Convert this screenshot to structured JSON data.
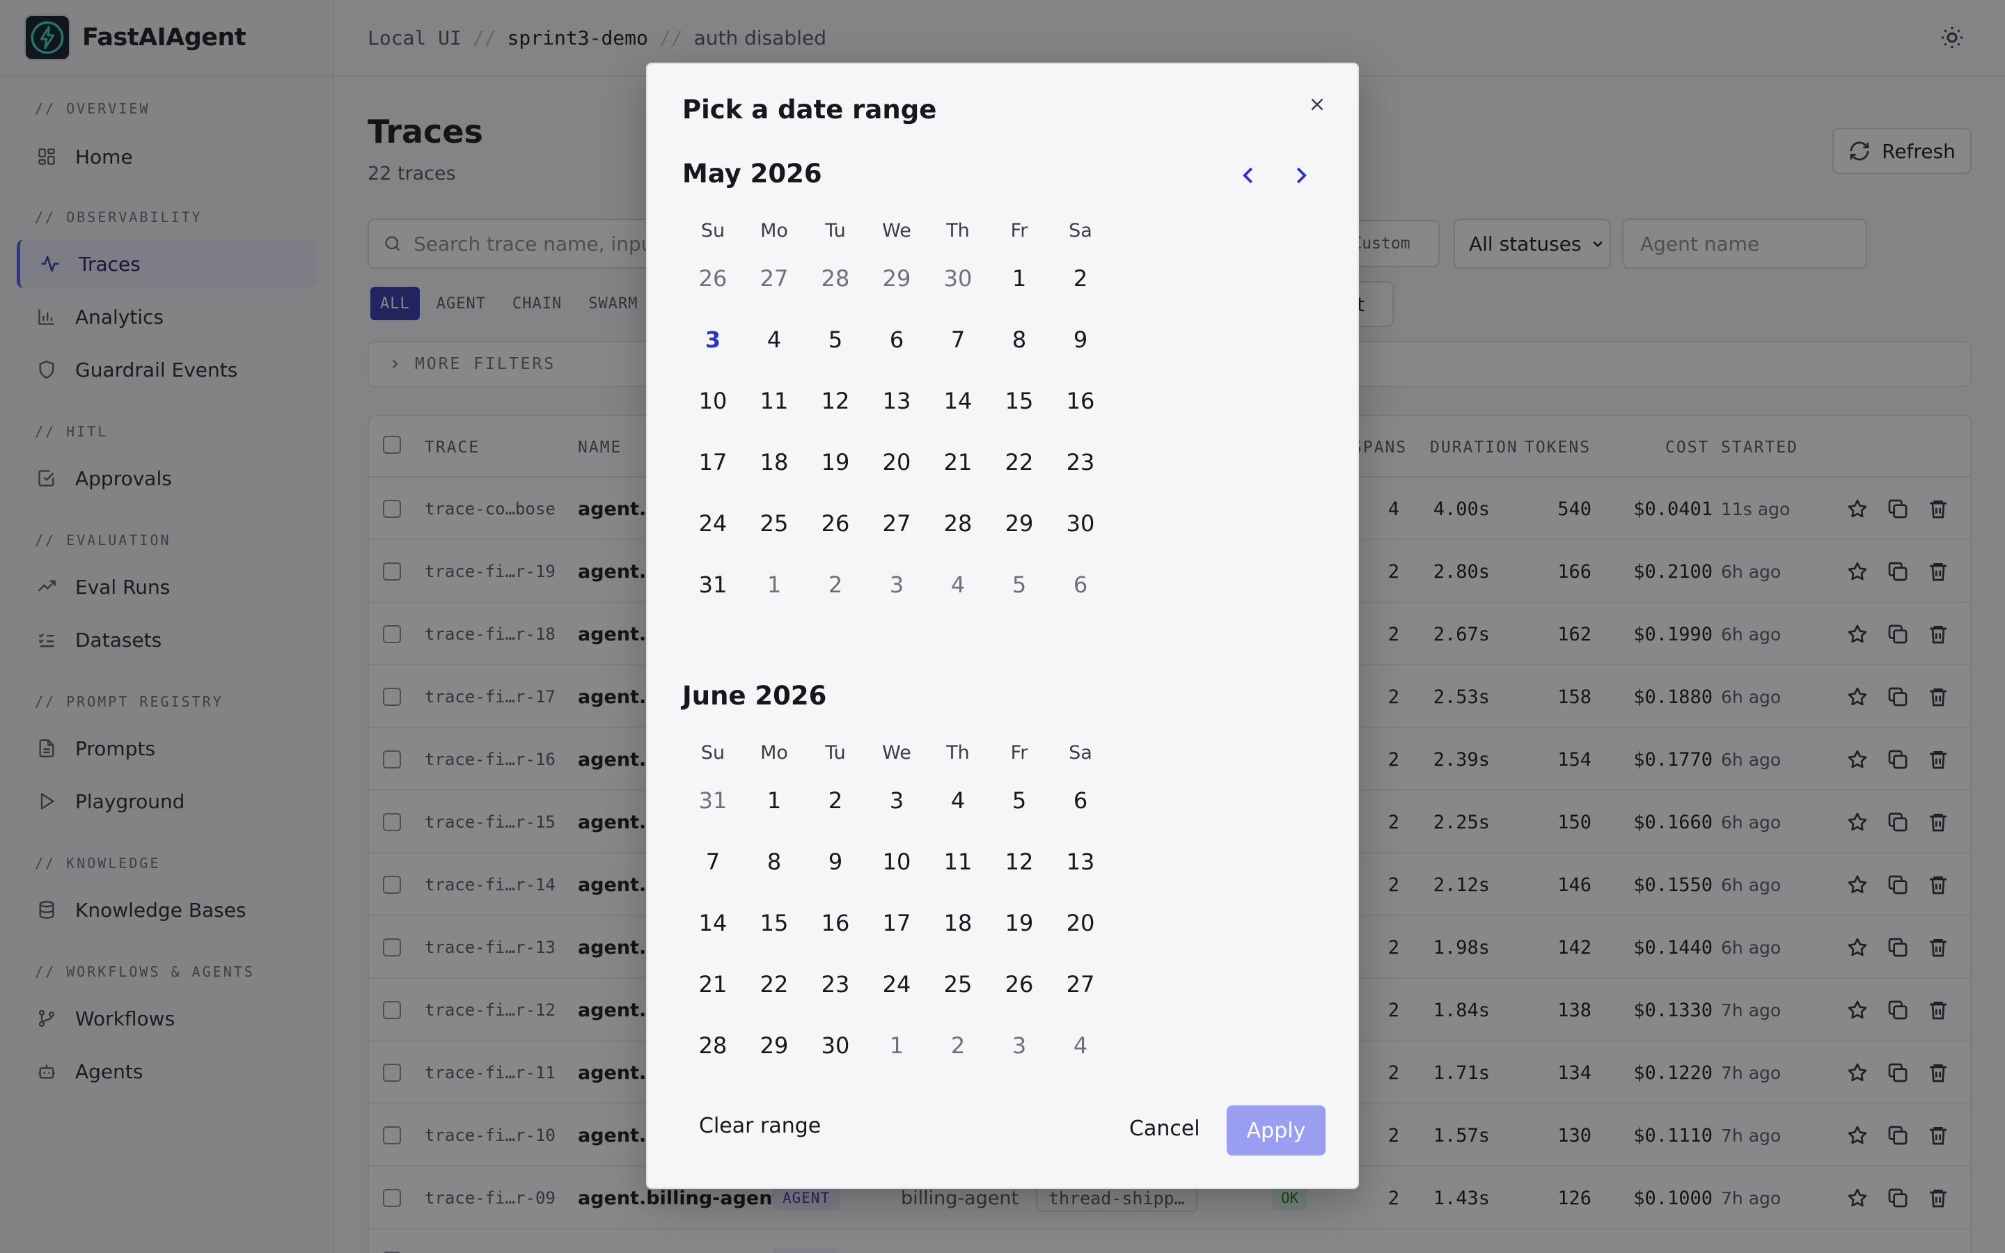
{
  "brand": {
    "name": "FastAIAgent"
  },
  "sidebar": {
    "sections": [
      {
        "label": "// OVERVIEW",
        "items": [
          {
            "label": "Home",
            "icon": "grid-icon"
          }
        ]
      },
      {
        "label": "// OBSERVABILITY",
        "items": [
          {
            "label": "Traces",
            "icon": "activity-icon",
            "active": true
          },
          {
            "label": "Analytics",
            "icon": "bar-chart-icon"
          },
          {
            "label": "Guardrail Events",
            "icon": "shield-icon"
          }
        ]
      },
      {
        "label": "// HITL",
        "items": [
          {
            "label": "Approvals",
            "icon": "check-square-icon"
          }
        ]
      },
      {
        "label": "// EVALUATION",
        "items": [
          {
            "label": "Eval Runs",
            "icon": "trending-up-icon"
          },
          {
            "label": "Datasets",
            "icon": "list-checks-icon"
          }
        ]
      },
      {
        "label": "// PROMPT REGISTRY",
        "items": [
          {
            "label": "Prompts",
            "icon": "file-text-icon"
          },
          {
            "label": "Playground",
            "icon": "play-icon"
          }
        ]
      },
      {
        "label": "// KNOWLEDGE",
        "items": [
          {
            "label": "Knowledge Bases",
            "icon": "database-icon"
          }
        ]
      },
      {
        "label": "// WORKFLOWS & AGENTS",
        "items": [
          {
            "label": "Workflows",
            "icon": "git-branch-icon"
          },
          {
            "label": "Agents",
            "icon": "bot-icon"
          }
        ]
      }
    ]
  },
  "topbar": {
    "crumb1": "Local UI",
    "crumb2": "sprint3-demo",
    "crumb3": "auth disabled",
    "divider": "//"
  },
  "page": {
    "title": "Traces",
    "subtitle": "22 traces",
    "refresh_label": "Refresh",
    "search_placeholder": "Search trace name, input,",
    "custom_label": "Custom",
    "status_value": "All statuses",
    "agent_placeholder": "Agent name",
    "chips": [
      "ALL",
      "AGENT",
      "CHAIN",
      "SWARM"
    ],
    "preset_label": "et",
    "more_filters": "MORE FILTERS"
  },
  "table": {
    "headers": {
      "trace": "TRACE",
      "name": "NAME",
      "spans": "SPANS",
      "duration": "DURATION",
      "tokens": "TOKENS",
      "cost": "COST",
      "started": "STARTED"
    },
    "rows": [
      {
        "trace": "trace-co…bose",
        "name": "agent.su",
        "spans": "4",
        "duration": "4.00s",
        "tokens": "540",
        "cost": "$0.0401",
        "started": "11s ago"
      },
      {
        "trace": "trace-fi…r-19",
        "name": "agent.b",
        "spans": "2",
        "duration": "2.80s",
        "tokens": "166",
        "cost": "$0.2100",
        "started": "6h ago"
      },
      {
        "trace": "trace-fi…r-18",
        "name": "agent.su",
        "spans": "2",
        "duration": "2.67s",
        "tokens": "162",
        "cost": "$0.1990",
        "started": "6h ago"
      },
      {
        "trace": "trace-fi…r-17",
        "name": "agent.b",
        "spans": "2",
        "duration": "2.53s",
        "tokens": "158",
        "cost": "$0.1880",
        "started": "6h ago"
      },
      {
        "trace": "trace-fi…r-16",
        "name": "agent.su",
        "spans": "2",
        "duration": "2.39s",
        "tokens": "154",
        "cost": "$0.1770",
        "started": "6h ago"
      },
      {
        "trace": "trace-fi…r-15",
        "name": "agent.b",
        "spans": "2",
        "duration": "2.25s",
        "tokens": "150",
        "cost": "$0.1660",
        "started": "6h ago"
      },
      {
        "trace": "trace-fi…r-14",
        "name": "agent.su",
        "spans": "2",
        "duration": "2.12s",
        "tokens": "146",
        "cost": "$0.1550",
        "started": "6h ago"
      },
      {
        "trace": "trace-fi…r-13",
        "name": "agent.b",
        "spans": "2",
        "duration": "1.98s",
        "tokens": "142",
        "cost": "$0.1440",
        "started": "6h ago"
      },
      {
        "trace": "trace-fi…r-12",
        "name": "agent.su",
        "spans": "2",
        "duration": "1.84s",
        "tokens": "138",
        "cost": "$0.1330",
        "started": "7h ago"
      },
      {
        "trace": "trace-fi…r-11",
        "name": "agent.b",
        "spans": "2",
        "duration": "1.71s",
        "tokens": "134",
        "cost": "$0.1220",
        "started": "7h ago"
      },
      {
        "trace": "trace-fi…r-10",
        "name": "agent.su",
        "spans": "2",
        "duration": "1.57s",
        "tokens": "130",
        "cost": "$0.1110",
        "started": "7h ago"
      },
      {
        "trace": "trace-fi…r-09",
        "name": "agent.billing-agent",
        "badge": "AGENT",
        "agent": "billing-agent",
        "thread": "thread-shipp…",
        "status": "OK",
        "spans": "2",
        "duration": "1.43s",
        "tokens": "126",
        "cost": "$0.1000",
        "started": "7h ago"
      }
    ],
    "partial_row": {
      "badge": "AGENT"
    }
  },
  "modal": {
    "title": "Pick a date range",
    "weekdays": [
      "Su",
      "Mo",
      "Tu",
      "We",
      "Th",
      "Fr",
      "Sa"
    ],
    "months": [
      {
        "title": "May 2026",
        "weeks": [
          [
            {
              "d": "26",
              "out": true
            },
            {
              "d": "27",
              "out": true
            },
            {
              "d": "28",
              "out": true
            },
            {
              "d": "29",
              "out": true
            },
            {
              "d": "30",
              "out": true
            },
            {
              "d": "1"
            },
            {
              "d": "2"
            }
          ],
          [
            {
              "d": "3",
              "today": true
            },
            {
              "d": "4"
            },
            {
              "d": "5"
            },
            {
              "d": "6"
            },
            {
              "d": "7"
            },
            {
              "d": "8"
            },
            {
              "d": "9"
            }
          ],
          [
            {
              "d": "10"
            },
            {
              "d": "11"
            },
            {
              "d": "12"
            },
            {
              "d": "13"
            },
            {
              "d": "14"
            },
            {
              "d": "15"
            },
            {
              "d": "16"
            }
          ],
          [
            {
              "d": "17"
            },
            {
              "d": "18"
            },
            {
              "d": "19"
            },
            {
              "d": "20"
            },
            {
              "d": "21"
            },
            {
              "d": "22"
            },
            {
              "d": "23"
            }
          ],
          [
            {
              "d": "24"
            },
            {
              "d": "25"
            },
            {
              "d": "26"
            },
            {
              "d": "27"
            },
            {
              "d": "28"
            },
            {
              "d": "29"
            },
            {
              "d": "30"
            }
          ],
          [
            {
              "d": "31"
            },
            {
              "d": "1",
              "out": true
            },
            {
              "d": "2",
              "out": true
            },
            {
              "d": "3",
              "out": true
            },
            {
              "d": "4",
              "out": true
            },
            {
              "d": "5",
              "out": true
            },
            {
              "d": "6",
              "out": true
            }
          ]
        ]
      },
      {
        "title": "June 2026",
        "weeks": [
          [
            {
              "d": "31",
              "out": true
            },
            {
              "d": "1"
            },
            {
              "d": "2"
            },
            {
              "d": "3"
            },
            {
              "d": "4"
            },
            {
              "d": "5"
            },
            {
              "d": "6"
            }
          ],
          [
            {
              "d": "7"
            },
            {
              "d": "8"
            },
            {
              "d": "9"
            },
            {
              "d": "10"
            },
            {
              "d": "11"
            },
            {
              "d": "12"
            },
            {
              "d": "13"
            }
          ],
          [
            {
              "d": "14"
            },
            {
              "d": "15"
            },
            {
              "d": "16"
            },
            {
              "d": "17"
            },
            {
              "d": "18"
            },
            {
              "d": "19"
            },
            {
              "d": "20"
            }
          ],
          [
            {
              "d": "21"
            },
            {
              "d": "22"
            },
            {
              "d": "23"
            },
            {
              "d": "24"
            },
            {
              "d": "25"
            },
            {
              "d": "26"
            },
            {
              "d": "27"
            }
          ],
          [
            {
              "d": "28"
            },
            {
              "d": "29"
            },
            {
              "d": "30"
            },
            {
              "d": "1",
              "out": true
            },
            {
              "d": "2",
              "out": true
            },
            {
              "d": "3",
              "out": true
            },
            {
              "d": "4",
              "out": true
            }
          ]
        ]
      }
    ],
    "clear_label": "Clear range",
    "cancel_label": "Cancel",
    "apply_label": "Apply"
  },
  "colors": {
    "accent": "#2c33c8",
    "apply": "#9a9ef0",
    "chip_active": "#3236a8"
  }
}
